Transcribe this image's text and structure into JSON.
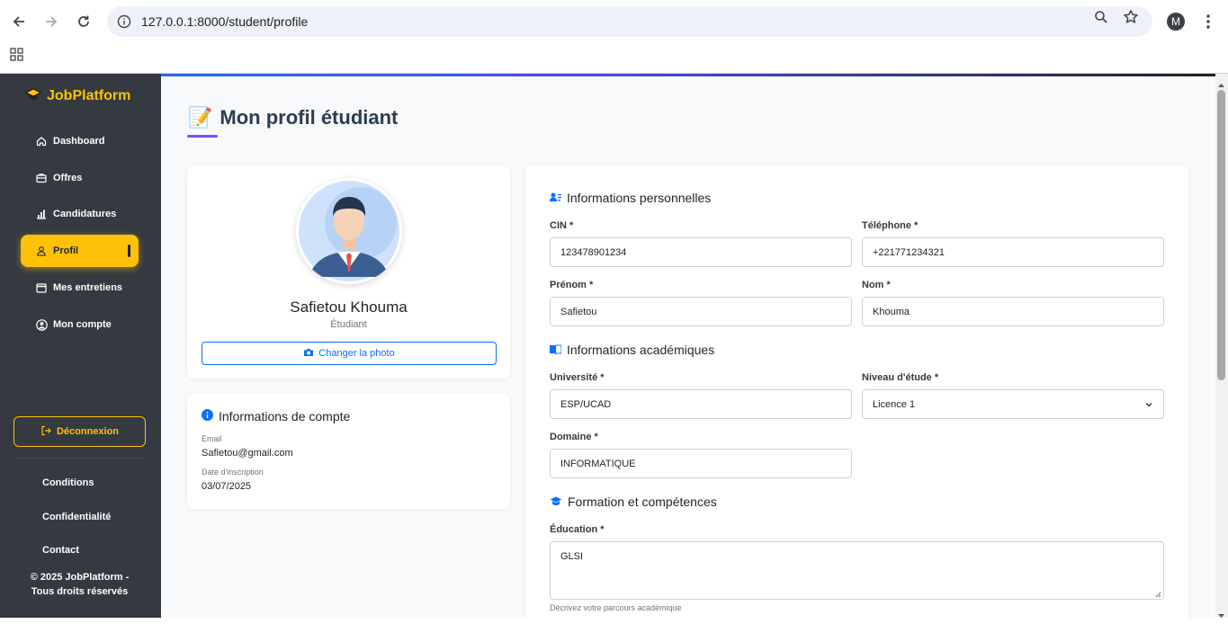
{
  "browser": {
    "url": "127.0.0.1:8000/student/profile",
    "profile_initial": "M"
  },
  "sidebar": {
    "brand": "JobPlatform",
    "items": [
      {
        "label": "Dashboard",
        "icon": "home-icon"
      },
      {
        "label": "Offres",
        "icon": "briefcase-icon"
      },
      {
        "label": "Candidatures",
        "icon": "bar-chart-icon"
      },
      {
        "label": "Profil",
        "icon": "user-icon",
        "active": true
      },
      {
        "label": "Mes entretiens",
        "icon": "calendar-icon"
      },
      {
        "label": "Mon compte",
        "icon": "user-circle-icon"
      }
    ],
    "logout_label": "Déconnexion",
    "footer_links": [
      "Conditions",
      "Confidentialité",
      "Contact"
    ],
    "copyright_line1": "© 2025 JobPlatform -",
    "copyright_line2": "Tous droits réservés"
  },
  "page": {
    "title_icon": "📝",
    "title": "Mon profil étudiant"
  },
  "profile": {
    "name": "Safietou Khouma",
    "role": "Étudiant",
    "change_photo_label": "Changer la photo"
  },
  "account": {
    "title": "Informations de compte",
    "email_label": "Email",
    "email": "Safietou@gmail.com",
    "date_label": "Date d'inscription",
    "date": "03/07/2025"
  },
  "form": {
    "personal_title": "Informations personnelles",
    "cin_label": "CIN *",
    "cin": "123478901234",
    "phone_label": "Téléphone *",
    "phone": "+221771234321",
    "firstname_label": "Prénom *",
    "firstname": "Safietou",
    "lastname_label": "Nom *",
    "lastname": "Khouma",
    "academic_title": "Informations académiques",
    "university_label": "Université *",
    "university": "ESP/UCAD",
    "level_label": "Niveau d'étude *",
    "level": "Licence 1",
    "domain_label": "Domaine *",
    "domain": "INFORMATIQUE",
    "training_title": "Formation et compétences",
    "education_label": "Éducation *",
    "education": "GLSI",
    "education_help": "Décrivez votre parcours académique"
  },
  "colors": {
    "sidebar_bg": "#343a40",
    "accent": "#ffc107",
    "primary": "#0d6efd"
  }
}
